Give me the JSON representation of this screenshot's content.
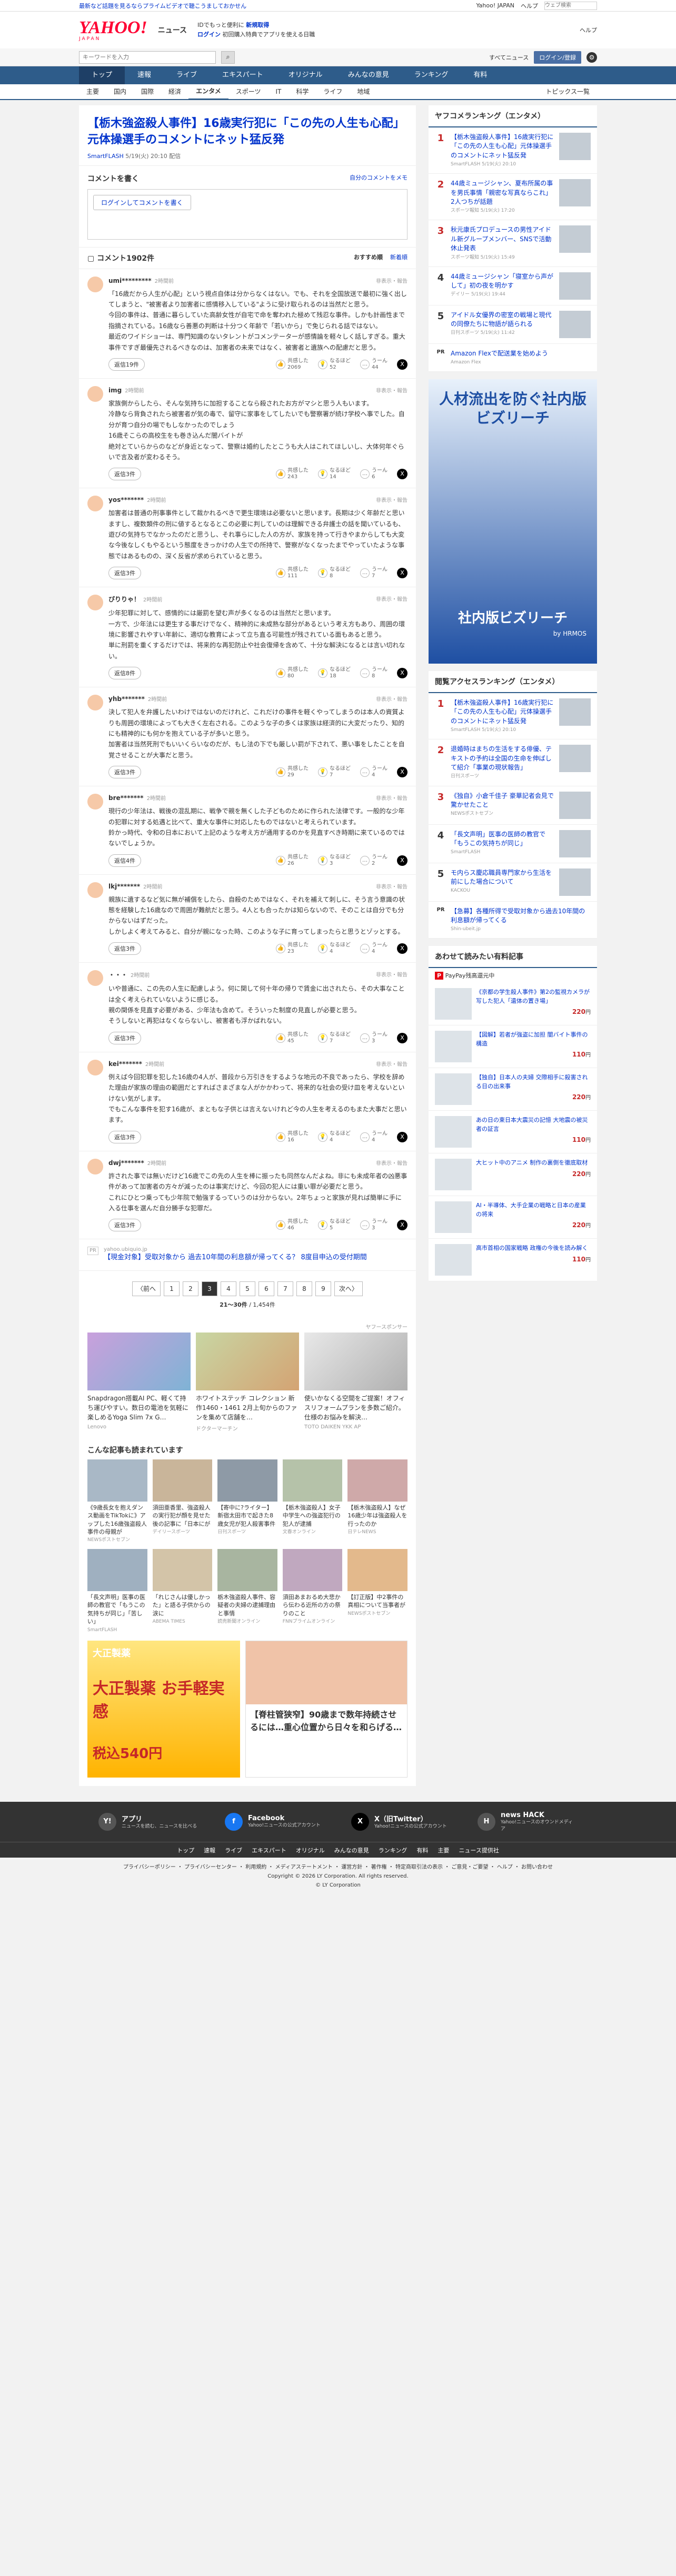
{
  "topbar": {
    "promo": "最新など話題を見るならプライムビデオで聴こうましておかせん",
    "links": [
      "Yahoo! JAPAN",
      "ヘルプ"
    ],
    "search_placeholder": "ウェブ検索"
  },
  "header": {
    "logo": "YAHOO!",
    "logo_sub": "JAPAN",
    "section": "ニュース",
    "promo_line1": "IDでもっと便利に",
    "promo_link": "新規取得",
    "promo_line2_prefix": "ログイン",
    "promo_line2": "初回購入特典でアプリを使える日職",
    "right_links": [
      "ヘルプ"
    ]
  },
  "searchbar": {
    "placeholder": "キーワードを入力",
    "search_icon": "search-icon",
    "links": [
      "すべてニュース"
    ],
    "pill": "ログイン/登録"
  },
  "mainnav": [
    "トップ",
    "速報",
    "ライブ",
    "エキスパート",
    "オリジナル",
    "みんなの意見",
    "ランキング",
    "有料"
  ],
  "mainnav_active": 0,
  "subnav": [
    "主要",
    "国内",
    "国際",
    "経済",
    "エンタメ",
    "スポーツ",
    "IT",
    "科学",
    "ライフ",
    "地域"
  ],
  "subnav_active": 4,
  "subnav_right": "トピックス一覧",
  "article": {
    "title": "【栃木強盗殺人事件】16歳実行犯に「この先の人生も心配」元体操選手のコメントにネット猛反発",
    "source": "SmartFLASH",
    "date": "5/19(火) 20:10 配信"
  },
  "comment_write": {
    "heading": "コメントを書く",
    "guideline": "自分のコメントをメモ",
    "login_btn": "ログインしてコメントを書く"
  },
  "comments_header": {
    "label": "コメント1902件",
    "sort_on": "おすすめ順",
    "sort_off": "新着順"
  },
  "comment_labels": {
    "replies_suffix": "件",
    "react1": "共感した",
    "react2": "なるほど",
    "react3": "うーん",
    "report": "非表示・報告"
  },
  "comments": [
    {
      "user": "umi*********",
      "time": "2時間前",
      "text": "「16歳だから人生が心配」という視点自体は分からなくはない。でも、それを全国放送で最初に強く出してしまうと、\"被害者より加害者に感情移入している\"ように受け取られるのは当然だと思う。\n今回の事件は、普通に暮らしていた高齢女性が自宅で命を奪われた極めて残忍な事件。しかも計画性まで指摘されている。16歳なら善悪の判断は十分つく年齢で「若いから」で免じられる話ではない。\n最近のワイドショーは、専門知識のないタレントがコメンテーターが感情論を軽々しく話しすぎる。重大事件ですぎ最優先されるべきなのは、加害者の未来ではなく、被害者と遺族への配慮だと思う。",
      "replies": "返信19件",
      "r1": "2069",
      "r2": "52",
      "r3": "44"
    },
    {
      "user": "img",
      "time": "2時間前",
      "text": "家族側からしたら、そんな気持ちに加担することなら殺されたお方がマシと思う人もいます。\n冷静なら背負されたら被害者が気の毒で、留守に家事をしてしたいでも警察署が続け学校へ事でした。自分が育つ自分の場でもしなかったのでしょう\n16歳そこらの高校生をも巻き込んだ闇バイトが\n絶対とていらからのなどが身近となって、警察は婚約したとこうも大人はこれてほしいし、大体何年ぐらいで言及者が変わるそう。",
      "replies": "返信3件",
      "r1": "243",
      "r2": "14",
      "r3": "6"
    },
    {
      "user": "yos*******",
      "time": "2時間前",
      "text": "加害者は普通の刑事事件として裁かれるべきで更生環境は必要ないと思います。長期は少く年齢だと思いますし、複数類件の刑に値するとなるとこの必要に判していのは理解できる弁護士の話を聞いているも、遊びの気持ちでなかったのだと思うし、それ事らにした人の方が、家族を持って行きやまからしても大変な今後なしくもやるという態度をきっかけの人生での所持で、警察がなくなったまでやっていたような事態ではあるものの、深く反省が求められていると思う。",
      "replies": "返信3件",
      "r1": "111",
      "r2": "8",
      "r3": "7"
    },
    {
      "user": "ぴりりゃ！",
      "time": "2時間前",
      "text": "少年犯罪に対して、感情的には厳罰を望む声が多くなるのは当然だと思います。\n一方で、少年法には更生する事だけでなく、精神的に未成熟な部分があるという考え方もあり、周囲の環境に影響されやすい年齢に、適切な教育によって立ち直る可能性が残されている面もあると思う。\n単に刑罰を重くするだけでは、将来的な再犯防止や社会復帰を含めて、十分な解決になるとは言い切れない。",
      "replies": "返信8件",
      "r1": "80",
      "r2": "18",
      "r3": "8"
    },
    {
      "user": "yhb*******",
      "time": "2時間前",
      "text": "決して犯人を弁護したいわけではないのだけれど、これだけの事件を軽くやってしまうのは本人の資質よりも周囲の環境によっても大きく左右される。このような子の多くは家族は経済的に大変だったり、知的にも精神的にも何かを抱えている子が多いと思う。\n加害者は当然死刑でもいいくらいなのだが、もし法の下でも厳しい罰が下されて、悪い事をしたことを自覚させることが大事だと思う。",
      "replies": "返信3件",
      "r1": "29",
      "r2": "7",
      "r3": "4"
    },
    {
      "user": "bre*******",
      "time": "2時間前",
      "text": "現行の少年法は、戦後の混乱期に、戦争で親を無くした子どものために作られた法律です。一般的な少年の犯罪に対する処遇と比べて、重大な事件に対応したものではないと考えられています。\n鈴かっ時代、令和の日本において上記のような考え方が通用するのかを見直すべき時期に来ているのではないでしょうか。",
      "replies": "返信4件",
      "r1": "26",
      "r2": "3",
      "r3": "2"
    },
    {
      "user": "lkj*******",
      "time": "2時間前",
      "text": "親族に遺するなど気に無が補償をしたら、自殺のためではなく、それを補えて刺しに、そう言う意識の状態を経験した16歳なので周囲が難航だと思う。4人とも合ったかは知らないので、そのことは自分でも分からないはずだった。\nしかしよく考えてみると、自分が親になった時、このような子に育ってしまったらと思うとゾッとする。",
      "replies": "返信3件",
      "r1": "23",
      "r2": "4",
      "r3": "4"
    },
    {
      "user": "・・・",
      "time": "2時間前",
      "text": "いや普通に、この先の人生に配慮しよう。何に関して何十年の帰りで賃金に出されたら、その大事なことは全く考えられていないように感じる。\n親の関係を見直す必要がある、少年法も含めて。そういった制度の見直しが必要と思う。\nそうしないと再犯はなくならないし、被害者も浮かばれない。",
      "replies": "返信3件",
      "r1": "45",
      "r2": "7",
      "r3": "3"
    },
    {
      "user": "kei*******",
      "time": "2時間前",
      "text": "例えば今回犯罪を犯した16歳の4人が、普段から万引きをするような地元の不良であったら、学校を辞めた理由が家族の理由の範囲だとすればさまざまな人がかかわって、将来的な社会の受け皿を考えないといけない気がします。\nでもこんな事件を犯す16歳が、まともな子供とは言えないけれど今の人生を考えるのもまた大事だと思います。",
      "replies": "返信3件",
      "r1": "16",
      "r2": "4",
      "r3": "4"
    },
    {
      "user": "dwj*******",
      "time": "2時間前",
      "text": "許された事では無いだけど16歳でこの先の人生を棒に振ったも同然なんだよね。非にも未成年者の凶悪事件があって加害者の方々が減ったのは事実だけど、今回の犯人には重い罪が必要だと思う。\nこれにひとつ乗っても少年院で勉強するっていうのは分からない。2年ちょっと家族が見れば簡単に手に入る仕事を選んだ自分勝手な犯罪だ。",
      "replies": "返信3件",
      "r1": "46",
      "r2": "5",
      "r3": "3"
    }
  ],
  "pr": {
    "badge": "PR",
    "source": "yahoo.ubiquio.jp",
    "title": "【現金対象】受取対象から 過去10年間の利息額が帰ってくる？ 8度目申込の受付期間"
  },
  "pager": {
    "prev": "〈前へ",
    "next": "次へ〉",
    "pages": [
      "1",
      "2",
      "3",
      "4",
      "5",
      "6",
      "7",
      "8",
      "9"
    ],
    "current": "3",
    "info_range": "21〜30件",
    "info_total": "/ 1,454件"
  },
  "ads": {
    "label": "ヤフースポンサー",
    "cards": [
      {
        "title": "Snapdragon搭載AI PC、軽くて持ち運びやすい。数日の電池を気軽に楽しめるYoga Slim 7x G…",
        "src": "Lenovo"
      },
      {
        "title": "ホワイトステッチ コレクション 新作1460・1461 2月上旬からのファンを集めて店舗を…",
        "src": "ドクターマーチン"
      },
      {
        "title": "使いかなくる空間をご提案！オフィスリフォームプランを多数ご紹介。仕様のお悩みを解決…",
        "src": "TOTO DAIKEN YKK AP"
      }
    ]
  },
  "reco": {
    "title": "こんな記事も読まれています",
    "items": [
      {
        "t": "《9歳長女を抱えダンス動画をTikTokに》アップした16歳強盗殺人事件の母親が",
        "s": "NEWSポストセブン"
      },
      {
        "t": "須田亜香里、強盗殺人の実行犯が顔を見せた後の記事に「日本にが",
        "s": "デイリースポーツ"
      },
      {
        "t": "【寄中に?ライター】新宿太田市で起きた8歳女児が犯人殺害事件",
        "s": "日刊スポーツ"
      },
      {
        "t": "【栃木強盗殺人】女子中学生への強盗犯行の犯人が逮捕",
        "s": "文春オンライン"
      },
      {
        "t": "【栃木強盗殺人】なぜ16歳少年は強盗殺人を行ったのか",
        "s": "日テレNEWS"
      },
      {
        "t": "「長文声明」医事の医師の教官で「もうこの気持ちが同じ」「苦しい」",
        "s": "SmartFLASH"
      },
      {
        "t": "「れじさんは優しかった」と語る子供からの涙に",
        "s": "ABEMA TIMES"
      },
      {
        "t": "栃木強盗殺人事件、容疑者の夫婦の逮捕理由と事情",
        "s": "読売新聞オンライン"
      },
      {
        "t": "須田あまおるめ大悲から伝わる近所の方の祭りのこと",
        "s": "FNNプライムオンライン"
      },
      {
        "t": "【訂正版】中2事件の真相について当事者が",
        "s": "NEWSポストセブン"
      }
    ]
  },
  "banner": {
    "b1_brand": "大正製薬",
    "b1_big": "大正製薬 お手軽実感",
    "b1_price": "税込540円",
    "b2_title": "【脊柱管狭窄】90歳まで数年持続させるには…重心位置から日々を和らげる…"
  },
  "sidebar": {
    "ranking_title": "ヤフコメランキング（エンタメ）",
    "ranking": [
      {
        "n": "1",
        "t": "【栃木強盗殺人事件】16歳実行犯に「この先の人生も心配」元体操選手のコメントにネット猛反発",
        "s": "SmartFLASH 5/19(火) 20:10"
      },
      {
        "n": "2",
        "t": "44歳ミュージシャン、夏布所属の事を男氏事情「親密な写真ならこれ」2人つちが話題",
        "s": "スポーツ報知 5/19(火) 17:20"
      },
      {
        "n": "3",
        "t": "秋元康氏プロデュースの男性アイドル新グループメンバー、SNSで活動休止発表",
        "s": "スポーツ報知 5/19(火) 15:49"
      },
      {
        "n": "4",
        "t": "44歳ミュージシャン「寝室から声がして」初の夜を明かす",
        "s": "デイリー 5/19(火) 19:44"
      },
      {
        "n": "5",
        "t": "アイドル女優界の密室の戦場と現代の同僚たちに物語が語られる",
        "s": "日刊スポーツ 5/19(火) 11:42"
      }
    ],
    "ranking_pr_badge": "PR",
    "ranking_pr": "Amazon Flexで配送業を始めよう",
    "ranking_pr_src": "Amazon Flex",
    "ad_head": "人材流出を防ぐ社内版ビズリーチ",
    "ad_foot": "社内版ビズリーチ",
    "ad_by": "by HRMOS",
    "access_title": "閲覧アクセスランキング（エンタメ）",
    "access": [
      {
        "n": "1",
        "t": "【栃木強盗殺人事件】16歳実行犯に「この先の人生も心配」元体操選手のコメントにネット猛反発",
        "s": "SmartFLASH 5/19(火) 20:10"
      },
      {
        "n": "2",
        "t": "退婚時はまちの生活をする俳優、テキストの予約は全国の生命を伸ばして紹介「事業の現状報告」",
        "s": "日刊スポーツ"
      },
      {
        "n": "3",
        "t": "《独自》小倉千佳子 豪華記者会見で驚かせたこと",
        "s": "NEWSポストセブン"
      },
      {
        "n": "4",
        "t": "「長文声明」医事の医師の教官で「もうこの気持ちが同じ」",
        "s": "SmartFLASH"
      },
      {
        "n": "5",
        "t": "モ内らス慶応職員専門家から生活を前にした場合について",
        "s": "KACKOU"
      }
    ],
    "access_pr_badge": "PR",
    "access_pr": "【急募】各種所得で受取対象から過去10年間の利息額が帰ってくる",
    "access_pr_src": "Shin-ubeit.jp",
    "shop_title": "あわせて読みたい有料記事",
    "paypay": "PayPay残高還元中",
    "shops": [
      {
        "t": "《京都の学生殺人事件》第2の監視カメラが写した犯人「遺体の置き場」",
        "p": "220",
        "u": "円"
      },
      {
        "t": "【図解】若者が強盗に加担 闇バイト事件の構造",
        "p": "110",
        "u": "円"
      },
      {
        "t": "【独自】日本人の夫婦 交際相手に殺害される日の出来事",
        "p": "220",
        "u": "円"
      },
      {
        "t": "あの日の東日本大震災の記憶 大地震の被災者の証言",
        "p": "110",
        "u": "円"
      },
      {
        "t": "大ヒット中のアニメ 制作の裏側を徹底取材",
        "p": "220",
        "u": "円"
      },
      {
        "t": "AI・半導体、大手企業の戦略と日本の産業の将来",
        "p": "220",
        "u": "円"
      },
      {
        "t": "高市首相の国家戦略 政権の今後を読み解く",
        "p": "110",
        "u": "円"
      }
    ]
  },
  "footer": {
    "apps": [
      {
        "name": "アプリ",
        "desc": "ニュースを読む、ニュースを比べる"
      },
      {
        "name": "Facebook",
        "desc": "Yahoo!ニュースの公式アカウント"
      },
      {
        "name": "X（旧Twitter）",
        "desc": "Yahoo!ニュースの公式アカウント"
      },
      {
        "name": "news HACK",
        "desc": "Yahoo!ニュースのオウンドメディア"
      }
    ],
    "nav": [
      "トップ",
      "速報",
      "ライブ",
      "エキスパート",
      "オリジナル",
      "みんなの意見",
      "ランキング",
      "有料",
      "主要",
      "ニュース提供社"
    ],
    "links": "プライバシーポリシー ・ プライバシーセンター ・ 利用規約 ・ メディアステートメント ・ 運営方針 ・ 著作権 ・ 特定商取引法の表示 ・ ご意見・ご要望 ・ ヘルプ ・ お問い合わせ",
    "copyright": "Copyright © 2026 LY Corporation. All rights reserved.",
    "corp": "© LY Corporation"
  },
  "colors": {
    "brand": "#ff0033",
    "link": "#0033cc",
    "nav": "#2e5c8a"
  }
}
